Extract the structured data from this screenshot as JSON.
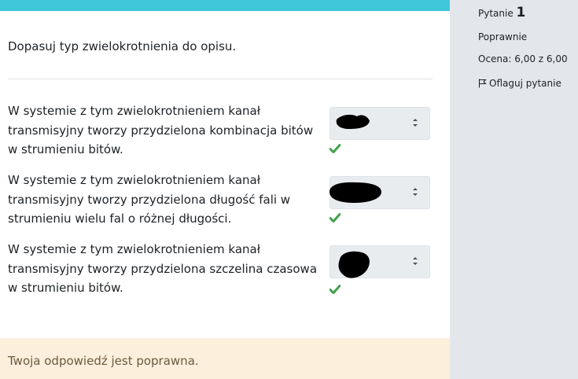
{
  "question": {
    "prompt": "Dopasuj typ zwielokrotnienia do opisu.",
    "rows": [
      {
        "text": "W systemie z tym zwielokrotnieniem kanał transmisyjny tworzy przydzielona kombinacja bitów w strumieniu bitów.",
        "selected": "",
        "status": "correct"
      },
      {
        "text": "W systemie z tym zwielokrotnieniem kanał transmisyjny tworzy przydzielona długość fali w strumieniu wielu fal o różnej długości.",
        "selected": "",
        "status": "correct"
      },
      {
        "text": "W systemie z tym zwielokrotnieniem kanał transmisyjny tworzy przydzielona szczelina czasowa w strumieniu bitów.",
        "selected": "",
        "status": "correct"
      }
    ],
    "feedback": "Twoja odpowiedź jest poprawna."
  },
  "info": {
    "question_label": "Pytanie",
    "question_number": "1",
    "state": "Poprawnie",
    "grade": "Ocena: 6,00 z 6,00",
    "flag_label": "Oflaguj pytanie"
  },
  "colors": {
    "accent": "#40c7d9",
    "correct": "#3fa14a",
    "feedback_bg": "#fcefdc",
    "sidebar_bg": "#e3e7eb"
  },
  "icons": {
    "correct": "check-icon",
    "flag": "flag-icon",
    "select": "select-arrows-icon"
  }
}
